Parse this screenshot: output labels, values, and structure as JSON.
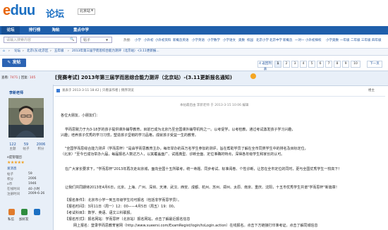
{
  "header": {
    "logo_main": "eduu",
    "logo_accent": "e",
    "logo_cn": "论坛",
    "city": "北京站"
  },
  "nav": [
    "论坛",
    "排行榜",
    "淘帖",
    "重点中学"
  ],
  "search": {
    "placeholder": "请输入搜索内容",
    "scope": "帖子",
    "hot_label": "热搜:",
    "hot_words": [
      "小学",
      "小升初",
      "小升初资料",
      "新概念英语",
      "小学英语",
      "小学数学",
      "小学语文",
      "奥数",
      "校园",
      "北京小学",
      "北京中学",
      "新概念",
      "一对一",
      "小升初择校",
      "小学奥数",
      "一年级",
      "二年级",
      "三年级",
      "四年级",
      "五年级",
      "六年级"
    ]
  },
  "breadcrumb": [
    "论坛",
    "北京(东)北京区",
    "五年级",
    "2013年第三届学而思综合能力测评（北京站）-(3.11更新报..."
  ],
  "toolbar": {
    "post_label": "发帖",
    "back_label": "4 返回列表",
    "pages": [
      "1",
      "2",
      "3",
      "4",
      "5",
      "6",
      "7",
      "8",
      "9",
      "10"
    ],
    "current_page": "1",
    "next_label": "下一页"
  },
  "thread": {
    "views_label": "查看:",
    "views": "7471",
    "replies_label": "回复:",
    "replies": "105",
    "title": "[竞赛考试] 2013年第三届学而思综合能力测评（北京站）-(3.11更新报名通知)"
  },
  "author": {
    "name": "李新老师",
    "stats": [
      {
        "value": "122",
        "label": "主题"
      },
      {
        "value": "59",
        "label": "帖子"
      },
      {
        "value": "2006",
        "label": "积分"
      }
    ],
    "level": "e度管理团",
    "badge": "发消息",
    "info": [
      {
        "label": "帖子",
        "value": "59"
      },
      {
        "label": "积分",
        "value": "2006"
      },
      {
        "label": "e币",
        "value": "1946"
      },
      {
        "label": "在线时间",
        "value": "40 小时"
      },
      {
        "label": "注册时间",
        "value": "2009-6-26"
      }
    ],
    "icons": [
      {
        "label": "私信",
        "color": "#e07b2c"
      },
      {
        "label": "加好友",
        "color": "#2e8c3e"
      },
      {
        "label": "",
        "color": "#1b6fc2"
      }
    ]
  },
  "post": {
    "meta": "发表于 2013-3-11 18:42 | 只看该作者 | 倒序浏览",
    "floor": "楼主",
    "edit_note": "本帖最后由 李新老师 于 2013-3-15 10:06 编辑",
    "paragraphs": [
      "各位大朋友、小朋友们：",
      "学而思致力于为3-18岁的孩子提供课外辅导教育，目前已成为北京乃至全国课外辅导机构之一。以考促学，以考检教，通过考试激发孩子学习兴趣，",
      "兴趣；培养孩子优秀的学习习惯，塑造孩子坚韧的学习品格，成就孩子受益一生的教育。",
      "\"全国学而思综合能力测评（学而思杯）\"是由学而思教育主办，每年举办的百万名学生参加的测评，旨在帮助学员了解在全市同类学生中的排名及目标定位，",
      "（北京）\"至今已成功举办六届，每届报名人数达万人，以其覆盖面广、试题典型、诊断全面、定位准确的特点，深得各年级学生和家长的认可。",
      "在广大家长要求下，\"学而思杯\"2013年再次走出京城，面向全国十五所联考，统一命题、同步考试、标准阅卷、个性诊断，让您在全市定位的同时，更与全国优秀学生一较高下！",
      "让我们共同期待2013年4月6日，北京、上海、广州、深圳、天津、武汉、西安、成都、杭州、苏州、郑州、太原、南京、重庆、沈阳，十五市优秀学生共谱\"学而思杯\"新篇章！",
      "【报名条件】：北京市小学一到五年级学生均可报名（包括非学而思学员）。",
      "【报名时间】：3月11日（周一）12：00——4月5日（周五）19：00。",
      "【考试科目】：数学、英语、语文三科联报。",
      "【报名形式】：报名网站：学而思杯（北京站）报名网站，点击了解最近报名信息",
      "网上报名：登录学而思教育官网（http://www.xueersi.com/ExamRegist/login/toLogin.action）在线报名。点击下方链接打印准考证。点击了解同城信息"
    ]
  },
  "colors": {
    "brand_blue": "#1b6fc2",
    "nav_bg": "#1f5fab",
    "accent_orange": "#e8650a",
    "highlight_red": "#c00"
  }
}
